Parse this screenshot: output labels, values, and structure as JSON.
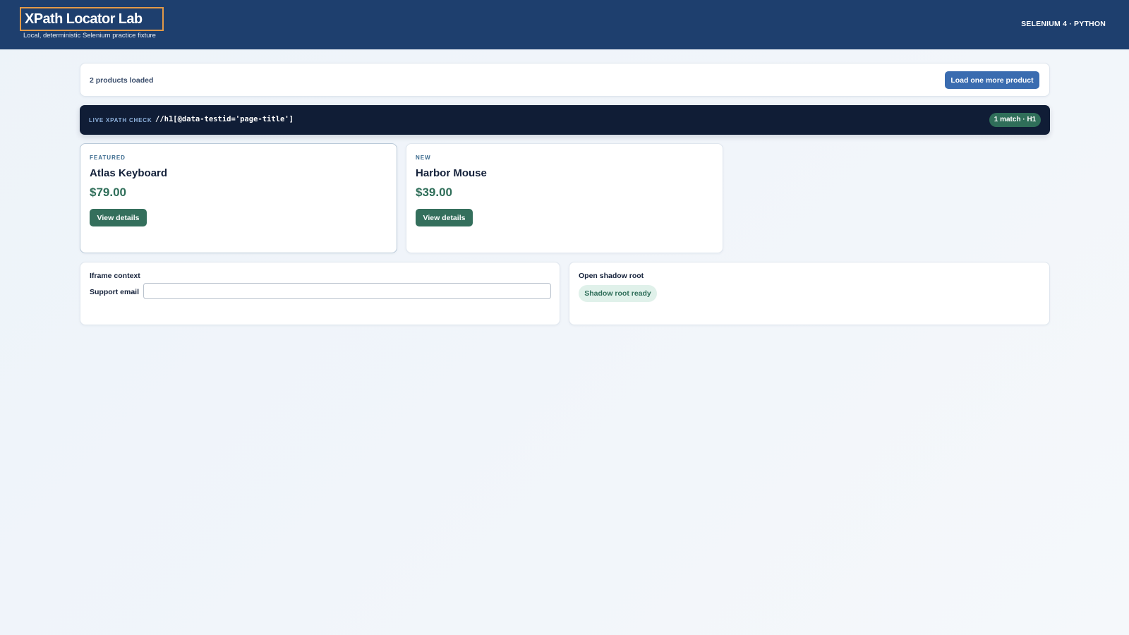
{
  "header": {
    "title": "XPath Locator Lab",
    "subtitle": "Local, deterministic Selenium practice fixture",
    "tag": "SELENIUM 4 · PYTHON"
  },
  "status": {
    "text": "2 products loaded",
    "load_button": "Load one more product"
  },
  "xpath_check": {
    "label": "LIVE XPATH CHECK",
    "expression": "//h1[@data-testid='page-title']",
    "result": "1 match · H1"
  },
  "products": [
    {
      "badge": "FEATURED",
      "name": "Atlas Keyboard",
      "price": "$79.00",
      "button": "View details"
    },
    {
      "badge": "NEW",
      "name": "Harbor Mouse",
      "price": "$39.00",
      "button": "View details"
    }
  ],
  "iframe_section": {
    "title": "Iframe context",
    "field_label": "Support email",
    "field_value": ""
  },
  "shadow_section": {
    "title": "Open shadow root",
    "status": "Shadow root ready"
  },
  "colors": {
    "header_bg": "#1e3f6e",
    "brand_outline": "#e39a48",
    "primary_button": "#3a6cb0",
    "success": "#2f6e59",
    "xpath_bar_bg": "#101d36"
  }
}
